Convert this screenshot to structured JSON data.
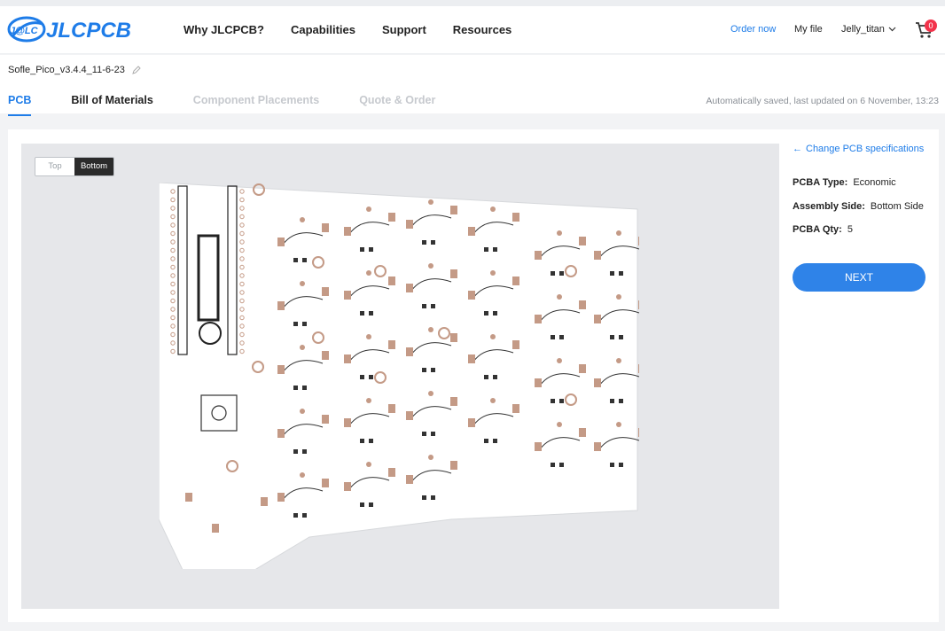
{
  "header": {
    "logo_text": "JLCPCB",
    "logo_badge": "J@LC",
    "nav": [
      "Why JLCPCB?",
      "Capabilities",
      "Support",
      "Resources"
    ],
    "order_now": "Order now",
    "my_file": "My file",
    "user": "Jelly_titan",
    "cart_count": "0"
  },
  "project": {
    "name": "Sofle_Pico_v3.4.4_11-6-23"
  },
  "tabs": [
    {
      "label": "PCB",
      "state": "active"
    },
    {
      "label": "Bill of Materials",
      "state": "normal"
    },
    {
      "label": "Component Placements",
      "state": "disabled"
    },
    {
      "label": "Quote & Order",
      "state": "disabled"
    }
  ],
  "saved_text": "Automatically saved, last updated on 6 November, 13:23",
  "viewer": {
    "toggle_top": "Top",
    "toggle_bottom": "Bottom",
    "selected_side": "Bottom"
  },
  "panel": {
    "back_link": "Change PCB specifications",
    "specs": [
      {
        "label": "PCBA Type:",
        "value": "Economic"
      },
      {
        "label": "Assembly Side:",
        "value": "Bottom Side"
      },
      {
        "label": "PCBA Qty:",
        "value": "5"
      }
    ],
    "next_label": "NEXT"
  },
  "colors": {
    "accent": "#1e7ce8",
    "button": "#2f83e8",
    "badge": "#f2334b",
    "pad": "#c49a86"
  }
}
